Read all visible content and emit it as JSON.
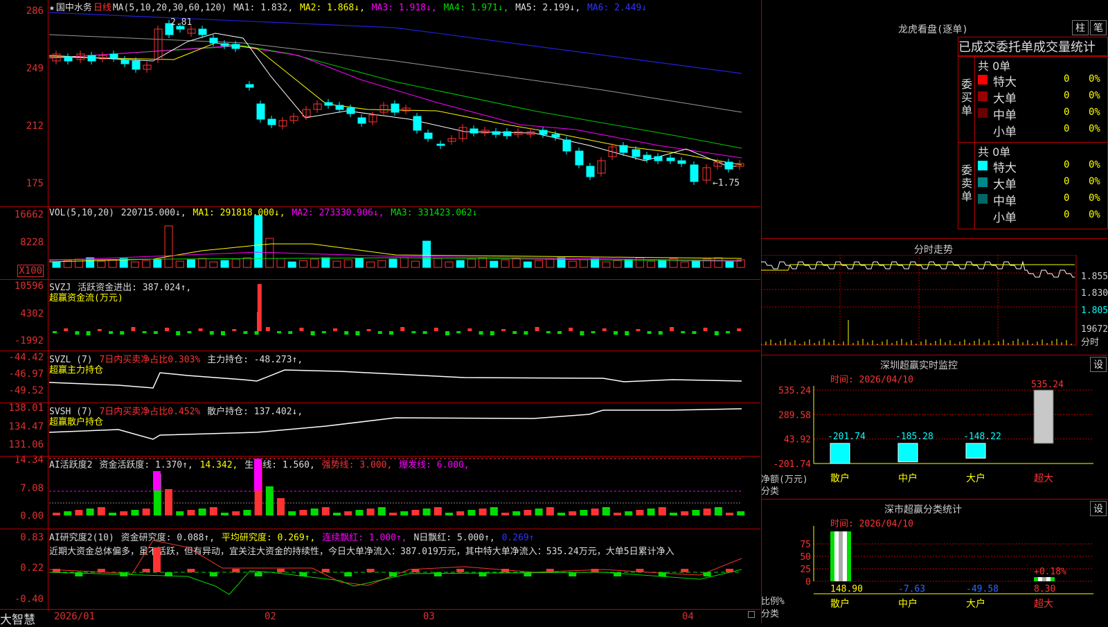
{
  "app": {
    "brand": "大智慧"
  },
  "kline": {
    "star": "★",
    "stock_name": "国中水务",
    "period": "日线",
    "ma_label": "MA(5,10,20,30,60,120)",
    "ma1": "MA1: 1.832,",
    "ma2": "MA2: 1.868↓,",
    "ma3": "MA3: 1.918↓,",
    "ma4": "MA4: 1.971↓,",
    "ma5": "MA5: 2.199↓,",
    "ma6": "MA6: 2.449↓",
    "yticks": [
      "286",
      "249",
      "212",
      "175"
    ],
    "high_label": "2.81",
    "low_label": "1.75",
    "colors": {
      "up": "#ff3333",
      "down": "#00ffff",
      "ma1": "#ffffff",
      "ma2": "#ffff00",
      "ma3": "#ff00ff",
      "ma4": "#00cc00",
      "ma5": "#9a9a9a",
      "ma6": "#2020dd"
    }
  },
  "vol": {
    "label": "VOL(5,10,20)",
    "value": "220715.000↓,",
    "ma1": "MA1: 291818.000↓,",
    "ma2": "MA2: 273330.906↓,",
    "ma3": "MA3: 331423.062↓",
    "yticks": [
      "16662",
      "8228",
      "X100"
    ]
  },
  "svzj": {
    "label": "SVZJ",
    "text": "活跃资金进出: 387.024↑,",
    "sub": "超赢资金流(万元)",
    "yticks": [
      "10596",
      "4302",
      "-1992"
    ]
  },
  "svzl": {
    "label": "SVZL (7)",
    "ratio": "7日内买卖净占比0.303%",
    "main": "主力持仓: -48.273↑,",
    "sub": "超赢主力持仓",
    "yticks": [
      "-44.42",
      "-46.97",
      "-49.52"
    ]
  },
  "svsh": {
    "label": "SVSH (7)",
    "ratio": "7日内买卖净占比0.452%",
    "retail": "散户持仓: 137.402↓,",
    "sub": "超赢散户持仓",
    "yticks": [
      "138.01",
      "134.47",
      "131.06"
    ]
  },
  "ai1": {
    "label": "AI活跃度2",
    "activity": "资金活跃度: 1.370↑,",
    "v2": "14.342,",
    "life": "生命线: 1.560,",
    "strong": "强势线: 3.000,",
    "burst": "爆发线: 6.000,",
    "yticks": [
      "14.34",
      "7.08",
      "0.00"
    ]
  },
  "ai2": {
    "label": "AI研究度2(10)",
    "research": "资金研究度: 0.088↑,",
    "avg": "平均研究度: 0.269↑,",
    "cont": "连续飘红: 1.000↑,",
    "nday": "N日飘红: 5.000↑,",
    "last": "0.269↑",
    "comment": "近期大资金总体偏多，虽不活跃，但有异动，宜关注大资金的持续性，今日大单净流入：387.019万元，其中特大单净流入：535.24万元，大单5日累计净入",
    "yticks": [
      "0.83",
      "0.22",
      "-0.40"
    ]
  },
  "dates": [
    "2026/01",
    "02",
    "03",
    "04"
  ],
  "dragon": {
    "title": "龙虎看盘(逐单)",
    "btn_col": "柱",
    "btn_note": "笔",
    "header": "已成交委托单成交量统计",
    "buy_vertical": "委买单",
    "sell_vertical": "委卖单",
    "buy_total": "共 0单",
    "sell_total": "共 0单",
    "buy_rows": [
      {
        "label": "特大",
        "val": "0",
        "pct": "0%",
        "color": "#ff0000"
      },
      {
        "label": "大单",
        "val": "0",
        "pct": "0%",
        "color": "#990000"
      },
      {
        "label": "中单",
        "val": "0",
        "pct": "0%",
        "color": "#6b0000"
      },
      {
        "label": "小单",
        "val": "0",
        "pct": "0%",
        "color": "#000000"
      }
    ],
    "sell_rows": [
      {
        "label": "特大",
        "val": "0",
        "pct": "0%",
        "color": "#00ffff"
      },
      {
        "label": "大单",
        "val": "0",
        "pct": "0%",
        "color": "#008888"
      },
      {
        "label": "中单",
        "val": "0",
        "pct": "0%",
        "color": "#006666"
      },
      {
        "label": "小单",
        "val": "0",
        "pct": "0%",
        "color": "#000000"
      }
    ]
  },
  "intraday": {
    "title": "分时走势",
    "yticks": [
      "1.855",
      "1.830",
      "1.805",
      "19672",
      "分时"
    ]
  },
  "sz_monitor": {
    "title": "深圳超赢实时监控",
    "set": "设",
    "time": "时间: 2026/04/10",
    "yticks": [
      "535.24",
      "289.58",
      "43.92",
      "-201.74"
    ],
    "ylabel": "净额(万元)",
    "xlabel": "分类",
    "categories": [
      "散户",
      "中户",
      "大户",
      "超大"
    ],
    "values": [
      -201.74,
      -185.28,
      -148.22,
      535.24
    ],
    "value_labels": [
      "-201.74",
      "-185.28",
      "-148.22",
      "535.24"
    ]
  },
  "sz_class": {
    "title": "深市超赢分类统计",
    "set": "设",
    "time": "时间: 2026/04/10",
    "yticks": [
      "75",
      "50",
      "25",
      "0"
    ],
    "ylabel": "比例%",
    "xlabel": "分类",
    "categories": [
      "散户",
      "中户",
      "大户",
      "超大"
    ],
    "values": [
      148.9,
      -7.63,
      -49.58,
      8.3
    ],
    "value_labels": [
      "148.90",
      "-7.63",
      "-49.58",
      "8.30"
    ],
    "extra_label": "+0.18%"
  },
  "chart_data": [
    {
      "type": "bar",
      "title": "深圳超赢实时监控",
      "xlabel": "分类",
      "ylabel": "净额(万元)",
      "categories": [
        "散户",
        "中户",
        "大户",
        "超大"
      ],
      "values": [
        -201.74,
        -185.28,
        -148.22,
        535.24
      ],
      "ylim": [
        -201.74,
        535.24
      ]
    },
    {
      "type": "bar",
      "title": "深市超赢分类统计",
      "xlabel": "分类",
      "ylabel": "比例%",
      "categories": [
        "散户",
        "中户",
        "大户",
        "超大"
      ],
      "values": [
        148.9,
        -7.63,
        -49.58,
        8.3
      ],
      "ylim": [
        0,
        75
      ]
    }
  ]
}
